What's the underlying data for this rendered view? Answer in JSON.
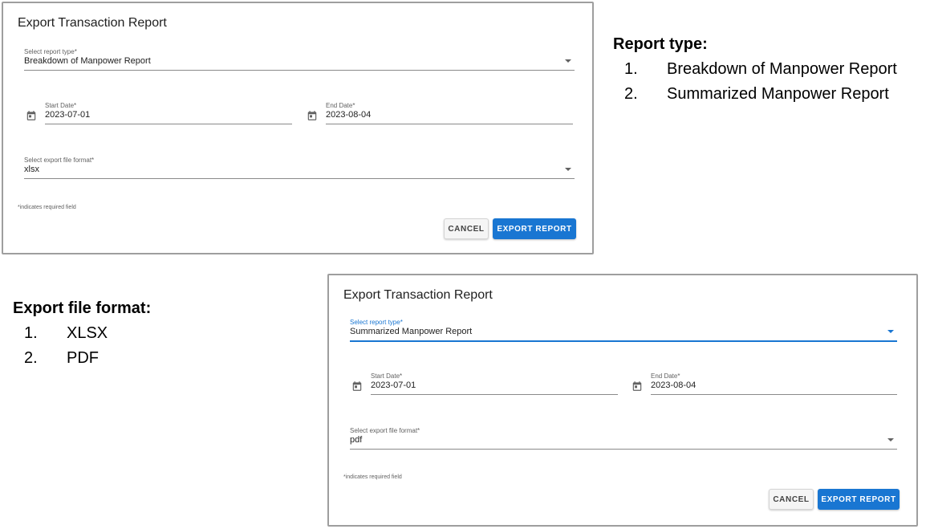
{
  "annotations": {
    "report_type": {
      "heading": "Report type:",
      "items": [
        {
          "num": "1.",
          "text": "Breakdown of Manpower Report"
        },
        {
          "num": "2.",
          "text": "Summarized Manpower Report"
        }
      ]
    },
    "export_format": {
      "heading": "Export file format:",
      "items": [
        {
          "num": "1.",
          "text": "XLSX"
        },
        {
          "num": "2.",
          "text": "PDF"
        }
      ]
    }
  },
  "dialogs": [
    {
      "title": "Export Transaction Report",
      "report_type_label": "Select report type*",
      "report_type_value": "Breakdown of Manpower Report",
      "start_date_label": "Start Date*",
      "start_date_value": "2023-07-01",
      "end_date_label": "End Date*",
      "end_date_value": "2023-08-04",
      "format_label": "Select export file format*",
      "format_value": "xlsx",
      "required_note": "*indicates required field",
      "cancel_label": "CANCEL",
      "export_label": "EXPORT REPORT"
    },
    {
      "title": "Export Transaction Report",
      "report_type_label": "Select report type*",
      "report_type_value": "Summarized Manpower Report",
      "start_date_label": "Start Date*",
      "start_date_value": "2023-07-01",
      "end_date_label": "End Date*",
      "end_date_value": "2023-08-04",
      "format_label": "Select export file format*",
      "format_value": "pdf",
      "required_note": "*indicates required field",
      "cancel_label": "CANCEL",
      "export_label": "EXPORT REPORT"
    }
  ],
  "colors": {
    "accent": "#1976d2",
    "dialog_border": "#9e9e9e",
    "cancel_bg": "#f5f5f5"
  },
  "icons": {
    "date": "calendar-icon",
    "select": "dropdown-arrow-icon"
  }
}
